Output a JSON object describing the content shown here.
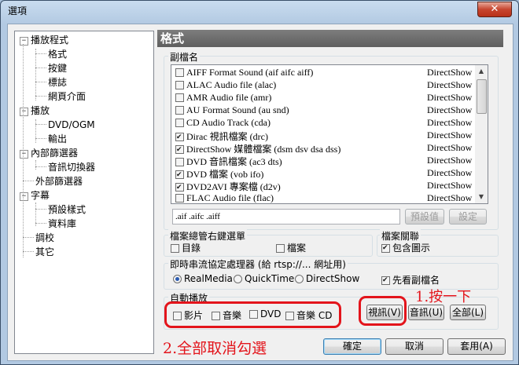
{
  "window": {
    "title": "選項",
    "close_glyph": "✕"
  },
  "tree": {
    "items": [
      {
        "label": "播放程式",
        "expander": "−"
      },
      {
        "label": "格式"
      },
      {
        "label": "按鍵"
      },
      {
        "label": "標誌"
      },
      {
        "label": "網頁介面"
      },
      {
        "label": "播放",
        "expander": "−"
      },
      {
        "label": "DVD/OGM"
      },
      {
        "label": "輸出"
      },
      {
        "label": "內部篩選器",
        "expander": "−"
      },
      {
        "label": "音訊切換器"
      },
      {
        "label": "外部篩選器"
      },
      {
        "label": "字幕",
        "expander": "−"
      },
      {
        "label": "預設樣式"
      },
      {
        "label": "資料庫"
      },
      {
        "label": "調校"
      },
      {
        "label": "其它"
      }
    ]
  },
  "panel": {
    "title": "格式"
  },
  "extensions": {
    "group_label": "副檔名",
    "rows": [
      {
        "name": "AIFF Format Sound (aif aifc aiff)",
        "engine": "DirectShow",
        "checked": false
      },
      {
        "name": "ALAC Audio file (alac)",
        "engine": "DirectShow",
        "checked": false
      },
      {
        "name": "AMR Audio file (amr)",
        "engine": "DirectShow",
        "checked": false
      },
      {
        "name": "AU Format Sound (au snd)",
        "engine": "DirectShow",
        "checked": false
      },
      {
        "name": "CD Audio Track (cda)",
        "engine": "DirectShow",
        "checked": false
      },
      {
        "name": "Dirac 視訊檔案 (drc)",
        "engine": "DirectShow",
        "checked": true
      },
      {
        "name": "DirectShow 媒體檔案 (dsm dsv dsa dss)",
        "engine": "DirectShow",
        "checked": true
      },
      {
        "name": "DVD 音訊檔案 (ac3 dts)",
        "engine": "DirectShow",
        "checked": false
      },
      {
        "name": "DVD 檔案 (vob ifo)",
        "engine": "DirectShow",
        "checked": true
      },
      {
        "name": "DVD2AVI 專案檔 (d2v)",
        "engine": "DirectShow",
        "checked": true
      },
      {
        "name": "FLAC Audio file (flac)",
        "engine": "DirectShow",
        "checked": false
      }
    ],
    "ext_value": ".aif .aifc .aiff",
    "default_button": "預設值",
    "set_button": "設定"
  },
  "shell": {
    "group_label": "檔案總管右鍵選單",
    "directory": "目錄",
    "files": "檔案"
  },
  "assoc": {
    "group_label": "檔案關聯",
    "include_icons": "包含圖示"
  },
  "rtsp": {
    "group_label": "即時串流協定處理器 (給 rtsp://... 網址用)",
    "options": [
      "RealMedia",
      "QuickTime",
      "DirectShow"
    ],
    "selected": "RealMedia",
    "check_ext": "先看副檔名"
  },
  "autoplay": {
    "group_label": "自動播放",
    "items": [
      "影片",
      "音樂",
      "DVD",
      "音樂 CD"
    ]
  },
  "select_buttons": {
    "video": "視訊(V)",
    "audio": "音訊(U)",
    "all": "全部(L)"
  },
  "footer": {
    "ok": "確定",
    "cancel": "取消",
    "apply": "套用(A)"
  },
  "annotations": {
    "step1": "1.按一下",
    "step2": "2.全部取消勾選",
    "color": "#e3141b"
  }
}
